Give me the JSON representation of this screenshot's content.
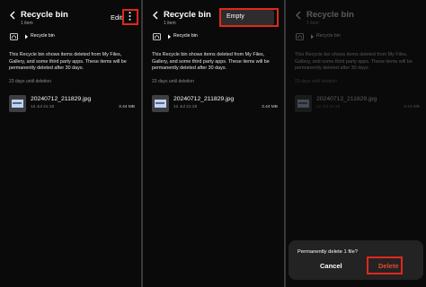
{
  "panels": [
    {
      "header": {
        "title": "Recycle bin",
        "subtitle": "1 item",
        "edit_label": "Edit"
      },
      "breadcrumb": {
        "label": "Recycle bin"
      },
      "info_text": "This Recycle bin shows items deleted from My Files, Gallery, and some third party apps. These items will be permanently deleted after 30 days.",
      "section_label": "23 days until deletion",
      "file": {
        "name": "20240712_211829.jpg",
        "date": "12 Jul 21:18",
        "size": "3.44 MB"
      }
    },
    {
      "header": {
        "title": "Recycle bin",
        "subtitle": "1 item"
      },
      "menu": {
        "items": [
          "Empty"
        ]
      },
      "breadcrumb": {
        "label": "Recycle bin"
      },
      "info_text": "This Recycle bin shows items deleted from My Files, Gallery, and some third party apps. These items will be permanently deleted after 30 days.",
      "section_label": "23 days until deletion",
      "file": {
        "name": "20240712_211829.jpg",
        "date": "12 Jul 21:18",
        "size": "3.44 MB"
      }
    },
    {
      "header": {
        "title": "Recycle bin",
        "subtitle": "1 item"
      },
      "breadcrumb": {
        "label": "Recycle bin"
      },
      "info_text": "This Recycle bin shows items deleted from My Files, Gallery, and some third party apps. These items will be permanently deleted after 30 days.",
      "section_label": "23 days until deletion",
      "file": {
        "name": "20240712_211829.jpg",
        "date": "12 Jul 21:18",
        "size": "3.44 MB"
      },
      "dialog": {
        "title": "Permanently delete 1 file?",
        "cancel_label": "Cancel",
        "delete_label": "Delete"
      }
    }
  ],
  "colors": {
    "highlight": "#e0281a",
    "delete": "#e8442e",
    "background": "#0a0a0a"
  },
  "icons": [
    "back-arrow-icon",
    "more-options-icon",
    "home-folder-icon",
    "chevron-right-icon",
    "image-thumbnail-icon"
  ]
}
